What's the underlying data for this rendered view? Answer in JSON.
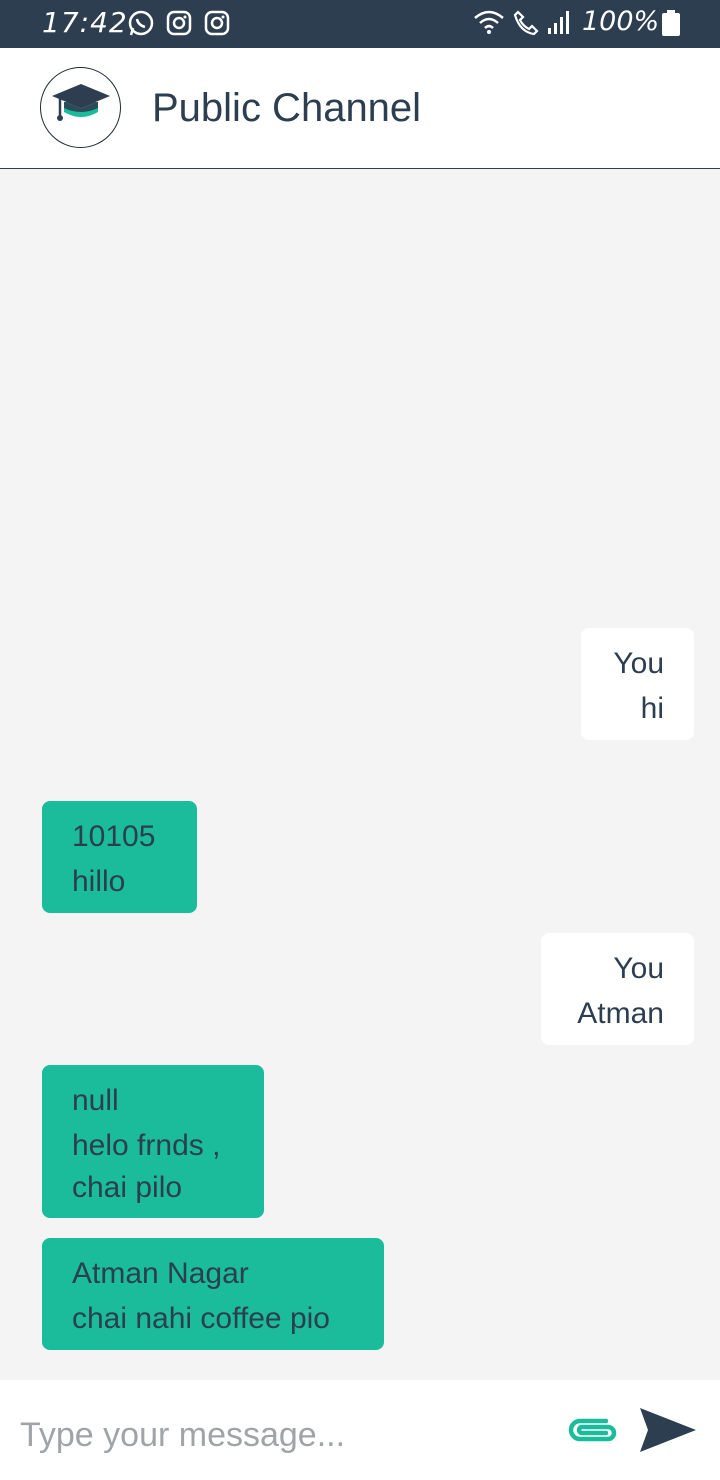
{
  "status_bar": {
    "time": "17:42",
    "battery": "100%",
    "icons": [
      "whatsapp-icon",
      "instagram-icon",
      "instagram-icon",
      "wifi-icon",
      "call-icon",
      "signal-icon",
      "battery-icon"
    ]
  },
  "header": {
    "title": "Public Channel",
    "logo_icon": "graduation-cap-icon"
  },
  "messages": [
    {
      "sender": "You",
      "text": "hi",
      "side": "right"
    },
    {
      "sender": "10105",
      "text": "hillo",
      "side": "left"
    },
    {
      "sender": "You",
      "text": "Atman",
      "side": "right"
    },
    {
      "sender": "null",
      "text": "helo frnds ,\nchai pilo",
      "side": "left"
    },
    {
      "sender": "Atman Nagar",
      "text": "chai nahi coffee pio",
      "side": "left"
    }
  ],
  "composer": {
    "placeholder": "Type your message...",
    "attach_icon": "paperclip-icon",
    "send_icon": "send-icon"
  },
  "colors": {
    "header_dark": "#2c3e50",
    "accent": "#1abc9c",
    "chat_bg": "#f4f4f4"
  }
}
